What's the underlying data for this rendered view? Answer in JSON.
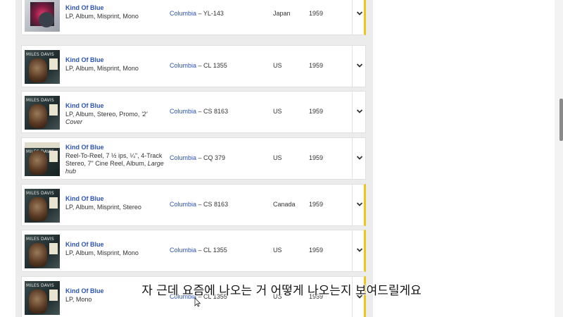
{
  "releases": [
    {
      "title": "Kind Of Blue",
      "format": [
        "LP, Album, Misprint, Mono"
      ],
      "format_italic": "",
      "label": "Columbia",
      "catno": "YL-143",
      "country": "Japan",
      "year": "1959",
      "cover": "japan",
      "highlight": true
    },
    {
      "title": "Kind Of Blue",
      "format": [
        "LP, Album, Misprint, Mono"
      ],
      "format_italic": "",
      "label": "Columbia",
      "catno": "CL 1355",
      "country": "US",
      "year": "1959",
      "cover": "standard",
      "highlight": false
    },
    {
      "title": "Kind Of Blue",
      "format": [
        "LP, Album, Stereo, Promo, "
      ],
      "format_italic": "'2' Cover",
      "label": "Columbia",
      "catno": "CS 8163",
      "country": "US",
      "year": "1959",
      "cover": "standard",
      "highlight": false
    },
    {
      "title": "Kind Of Blue",
      "format": [
        "Reel-To-Reel, 7 ½ ips, ¼\", 4-Track",
        "Stereo, 7\" Cine Reel, Album, "
      ],
      "format_italic": "Large hub",
      "label": "Columbia",
      "catno": "CQ 379",
      "country": "US",
      "year": "1959",
      "cover": "reel",
      "highlight": false
    },
    {
      "title": "Kind Of Blue",
      "format": [
        "LP, Album, Misprint, Stereo"
      ],
      "format_italic": "",
      "label": "Columbia",
      "catno": "CS 8163",
      "country": "Canada",
      "year": "1959",
      "cover": "standard",
      "highlight": true
    },
    {
      "title": "Kind Of Blue",
      "format": [
        "LP, Album, Misprint, Mono"
      ],
      "format_italic": "",
      "label": "Columbia",
      "catno": "CL 1355",
      "country": "US",
      "year": "1959",
      "cover": "standard",
      "highlight": true
    },
    {
      "title": "Kind Of Blue",
      "format": [
        "LP, Mono"
      ],
      "format_italic": "",
      "label": "Columbia",
      "catno": "CL 1355",
      "country": "US",
      "year": "1959",
      "cover": "standard",
      "highlight": true
    }
  ],
  "cover_text": "MILES DAVIS",
  "caption": "자 근데 요즘에 나오는 거 어떻게 나오는지 보여드릴게요",
  "colors": {
    "link": "#2d53b8",
    "highlight": "#f0c419",
    "panel": "#ececec"
  }
}
